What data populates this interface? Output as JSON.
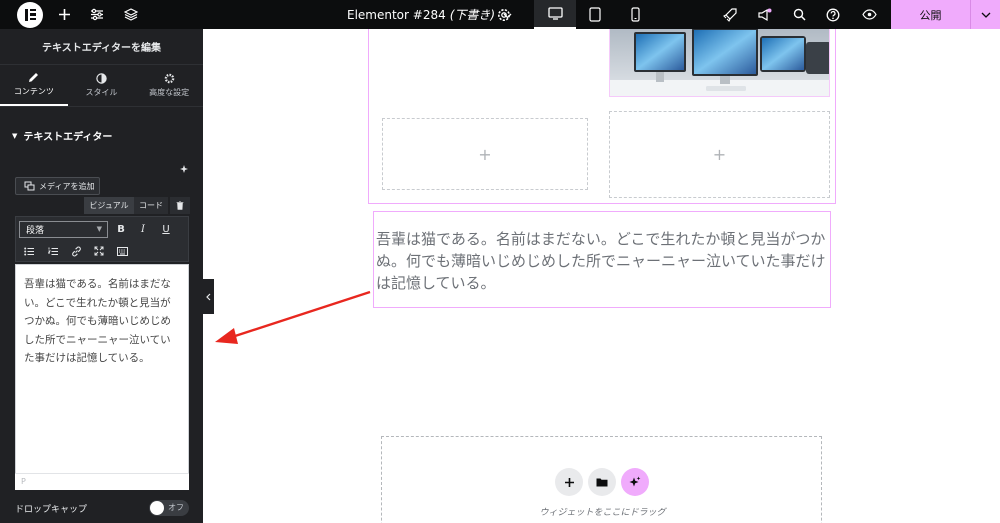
{
  "topbar": {
    "title": "Elementor #284",
    "draft": "(下書き)",
    "publish_label": "公開"
  },
  "sidebar": {
    "header_title": "テキストエディターを編集",
    "tabs": [
      {
        "label": "コンテンツ",
        "icon": "pencil-icon",
        "active": true
      },
      {
        "label": "スタイル",
        "icon": "half-circle-icon",
        "active": false
      },
      {
        "label": "高度な設定",
        "icon": "gear-icon",
        "active": false
      }
    ],
    "section_title": "テキストエディター",
    "add_media_label": "メディアを追加",
    "editor_tabs": {
      "visual": "ビジュアル",
      "code": "コード"
    },
    "format_select": "段落",
    "editor_content": "吾輩は猫である。名前はまだない。どこで生れたか頓と見当がつかぬ。何でも薄暗いじめじめした所でニャーニャー泣いていた事だけは記憶している。",
    "editor_status": "P",
    "dropcap_label": "ドロップキャップ",
    "dropcap_toggle": "オフ"
  },
  "canvas": {
    "text_widget": "吾輩は猫である。名前はまだない。どこで生れたか頓と見当がつかぬ。何でも薄暗いじめじめした所でニャーニャー泣いていた事だけは記憶している。",
    "drop_hint": "ウィジェットをここにドラッグ"
  },
  "colors": {
    "accent_pink": "#f0abfc",
    "annotation_arrow": "#e8271f",
    "sidebar_bg": "#202124",
    "topbar_bg": "#0c0d0e"
  }
}
